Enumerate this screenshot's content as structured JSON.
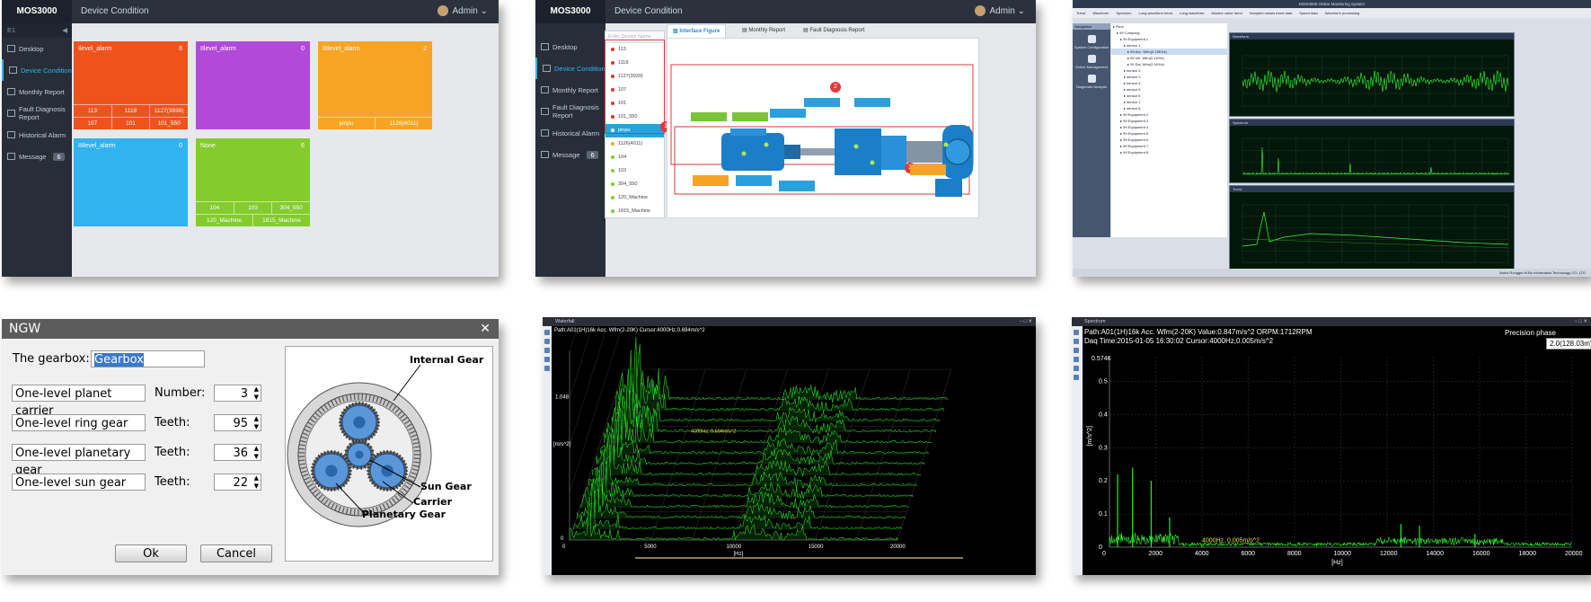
{
  "panel_device": {
    "brand": "MOS3000",
    "title": "Device Condition",
    "user": "Admin",
    "nav_header": "E1",
    "nav": [
      {
        "label": "Desktop"
      },
      {
        "label": "Device Condition"
      },
      {
        "label": "Monthly Report"
      },
      {
        "label": "Fault Diagnosis Report"
      },
      {
        "label": "Historical Alarm"
      },
      {
        "label": "Message",
        "badge": "6"
      }
    ],
    "tiles": [
      {
        "name": "Ilevel_alarm",
        "count": "6",
        "color": "#f0521e",
        "rows": [
          [
            "113",
            "1118",
            "1127(3939)"
          ],
          [
            "107",
            "101",
            "101_550"
          ]
        ]
      },
      {
        "name": "IIlevel_alarm",
        "count": "0",
        "color": "#b14ad8",
        "rows": []
      },
      {
        "name": "IIIlevel_alarm",
        "count": "2",
        "color": "#f7a424",
        "rows": [
          [
            "pinpu",
            "1126(4011)"
          ]
        ]
      },
      {
        "name": "IIIlevel_alarm",
        "count": "0",
        "color": "#30b3ee",
        "rows": []
      },
      {
        "name": "None",
        "count": "6",
        "color": "#84cc2e",
        "rows": [
          [
            "104",
            "103",
            "304_550"
          ],
          [
            "120_Machine",
            "1815_Machine"
          ]
        ]
      }
    ]
  },
  "panel_interface": {
    "brand": "MOS3000",
    "title": "Device Condition",
    "user": "Admin",
    "nav": [
      {
        "label": "Desktop"
      },
      {
        "label": "Device Condition"
      },
      {
        "label": "Monthly Report"
      },
      {
        "label": "Fault Diagnosis Report"
      },
      {
        "label": "Historical Alarm"
      },
      {
        "label": "Message",
        "badge": "6"
      }
    ],
    "search_placeholder": "Enter Device Name",
    "devices": [
      {
        "name": "113",
        "color": "#e0342d"
      },
      {
        "name": "1118",
        "color": "#e0342d"
      },
      {
        "name": "1127(3939)",
        "color": "#e0342d"
      },
      {
        "name": "107",
        "color": "#e0342d"
      },
      {
        "name": "101",
        "color": "#e0342d"
      },
      {
        "name": "101_550",
        "color": "#e0342d"
      },
      {
        "name": "pinpu",
        "color": "#f7a424"
      },
      {
        "name": "1126(4011)",
        "color": "#f7a424"
      },
      {
        "name": "104",
        "color": "#84cc2e"
      },
      {
        "name": "103",
        "color": "#84cc2e"
      },
      {
        "name": "304_550",
        "color": "#84cc2e"
      },
      {
        "name": "120_Machine",
        "color": "#84cc2e"
      },
      {
        "name": "1815_Machine",
        "color": "#84cc2e"
      }
    ],
    "tabs": [
      "Interface Figure",
      "Monthly Report",
      "Fault Diagnosis Report"
    ],
    "markers": [
      "1",
      "2",
      "3"
    ]
  },
  "panel_monitor": {
    "window_title": "MOS3000 Online Monitoring System",
    "toolbar": [
      "Trend",
      "Waveform",
      "Spectrum",
      "Long waveform trend",
      "Long waveform",
      "Monitor value trend",
      "Sampled values trend data",
      "Speed data",
      "Waveform processing"
    ],
    "nav_header": "Navigation",
    "nav": [
      "System Configuration",
      "Online Management",
      "Diagnostic Analysis"
    ],
    "tree": [
      "Root",
      "99 Company",
      "99 Equipment 1",
      "sensor 1",
      "99 Acc. Wfm(2-10KHz)",
      "99 Vel. Wfm(2-1KHz)",
      "99 Dis. Wfm(2-1KHz)",
      "sensor 2",
      "sensor 3",
      "sensor 4",
      "sensor 5",
      "sensor 6",
      "sensor 7",
      "sensor 8",
      "99 Equipment 2",
      "99 Equipment 3",
      "99 Equipment 4",
      "99 Equipment 5",
      "99 Equipment 6",
      "99 Equipment 7",
      "99 Equipment 8"
    ],
    "graph_titles": [
      "Waveform",
      "Spectrum",
      "Trend"
    ],
    "status": "Anhui Ronggin M-Bo Information Technology CO.,LTD"
  },
  "panel_ngw": {
    "title": "NGW",
    "gearbox_label": "The gearbox:",
    "gearbox_value": "Gearbox",
    "rows": [
      {
        "name": "One-level planet carrier",
        "label": "Number:",
        "value": "3"
      },
      {
        "name": "One-level ring gear",
        "label": "Teeth:",
        "value": "95"
      },
      {
        "name": "One-level planetary gear",
        "label": "Teeth:",
        "value": "36"
      },
      {
        "name": "One-level sun gear",
        "label": "Teeth:",
        "value": "22"
      }
    ],
    "ok": "Ok",
    "cancel": "Cancel",
    "gear_labels": {
      "internal": "Internal Gear",
      "sun": "Sun Gear",
      "carrier": "Carrier",
      "planetary": "Planetary Gear"
    }
  },
  "panel_waterfall": {
    "window_title": "Waterfall",
    "path_info": "Path:A01(1H)16k Acc. Wfm(2-20K)   Cursor:4000Hz,0.694m/s^2",
    "cursor_label": "4000Hz, 0.694m/s^2",
    "chart_data": {
      "type": "area",
      "ylabel": "[m/s^2]",
      "xlabel": "[Hz]",
      "y_ticks": [
        "1.048",
        "0"
      ],
      "x_ticks": [
        "0",
        "5000",
        "10000",
        "15000",
        "20000"
      ]
    }
  },
  "panel_spectrum": {
    "window_title": "Spectrum",
    "path_info": "Path:A01(1H)16k Acc. Wfm(2-20K)   Value:0.847m/s^2   ORPM:1712RPM",
    "time_info": "Daq Time:2015-01-05 16:30:02   Cursor:4000Hz,0.005m/s^2",
    "precision_label": "Precision phase",
    "precision_value": "2.0(128.03m)",
    "cursor_label": "4000Hz, 0.005m/s^2",
    "chart_data": {
      "type": "line",
      "ylabel": "[m/s^2]",
      "xlabel": "[Hz]",
      "y_max_label": "0.5746",
      "y_ticks": [
        "0.5",
        "0.4",
        "0.3",
        "0.2",
        "0.1",
        "0"
      ],
      "x_ticks": [
        "0",
        "2000",
        "4000",
        "6000",
        "8000",
        "10000",
        "12000",
        "14000",
        "16000",
        "18000",
        "20000"
      ],
      "peaks": [
        {
          "x": 350,
          "y": 0.22
        },
        {
          "x": 1000,
          "y": 0.24
        },
        {
          "x": 1800,
          "y": 0.2
        },
        {
          "x": 2600,
          "y": 0.09
        },
        {
          "x": 4000,
          "y": 0.005
        },
        {
          "x": 12600,
          "y": 0.07
        },
        {
          "x": 13400,
          "y": 0.065
        },
        {
          "x": 15800,
          "y": 0.04
        }
      ]
    }
  }
}
